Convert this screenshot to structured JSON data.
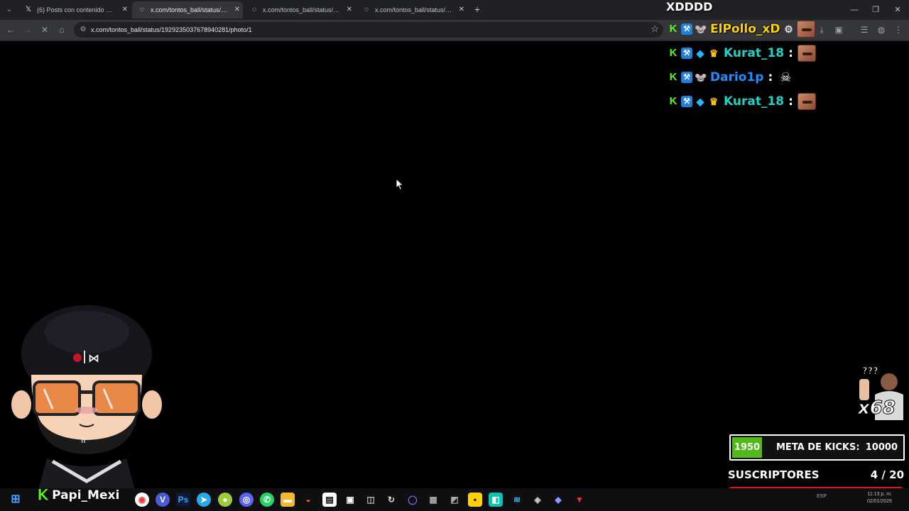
{
  "browser": {
    "tabs": [
      {
        "title": "(6) Posts con contenido multim",
        "favicon": "x-logo-icon",
        "active": false
      },
      {
        "title": "x.com/tontos_ball/status/1929",
        "favicon": "loading-icon",
        "active": true
      },
      {
        "title": "x.com/tontos_ball/status/1928",
        "favicon": "loading-icon",
        "active": false
      },
      {
        "title": "x.com/tontos_ball/status/1927",
        "favicon": "loading-icon",
        "active": false
      }
    ],
    "url": "x.com/tontos_ball/status/1929235037678940281/photo/1"
  },
  "chat": {
    "header": "XDDDD",
    "messages": [
      {
        "user": "ElPollo_xD",
        "color": "#ffd400",
        "emote": "face"
      },
      {
        "user": "Kurat_18",
        "color": "#22d1c8",
        "emote": "face"
      },
      {
        "user": "Dario1p",
        "color": "#1e8fff",
        "emote": "skull"
      },
      {
        "user": "Kurat_18",
        "color": "#22d1c8",
        "emote": "face"
      }
    ],
    "separator": ":"
  },
  "overlay": {
    "meme_text": "???",
    "multiplier": "x68",
    "kick_goal": {
      "current": "1950",
      "label": "META DE KICKS:",
      "target": "10000",
      "current_value": 1950,
      "target_value": 10000
    },
    "subs": {
      "label": "SUSCRIPTORES",
      "count": "4 / 20",
      "current": 4,
      "goal": 20
    },
    "streamer_k": "K",
    "streamer_name": "Papi_Mexi",
    "avatar_cap_logo": "◉ | ⊠"
  },
  "taskbar": {
    "lang": "ESP",
    "time": "11:13 p. m.",
    "date": "02/01/2026"
  },
  "colors": {
    "kick_green": "#53fc18",
    "sub_bar_border": "#e3161c"
  }
}
